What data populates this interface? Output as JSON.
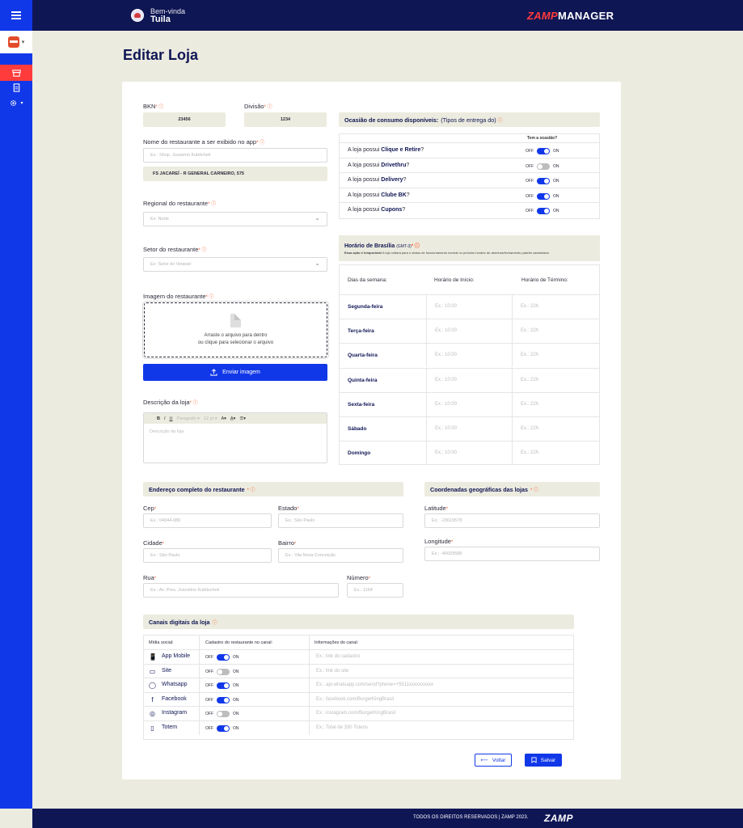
{
  "header": {
    "welcome_line": "Bem-vinda",
    "user_name": "Tuila",
    "brand_left": "ZAMP",
    "brand_right": "MANAGER"
  },
  "page": {
    "title": "Editar Loja"
  },
  "form": {
    "bkn": {
      "label": "BKN",
      "value": "23456"
    },
    "divisao": {
      "label": "Divisão",
      "value": "1234"
    },
    "nome_exibido": {
      "label": "Nome do restaurante a ser exibido no app",
      "placeholder": "Ex.: Shop. Jussemo Kubitchek",
      "value": "FS JACAREÍ - R GENERAL CARNEIRO, 575"
    },
    "regional": {
      "label": "Regional do restaurante",
      "placeholder": "Ex: Norte"
    },
    "setor": {
      "label": "Setor do restaurante",
      "placeholder": "Ex: Setor do Veiarari"
    },
    "imagem": {
      "label": "Imagem do restaurante",
      "drop_line1": "Arraste o arquivo para dentro",
      "drop_line2": "ou clique para selecionar o arquivo",
      "upload_label": "Enviar imagem"
    },
    "descricao": {
      "label": "Descrição da loja",
      "placeholder": "Descrição da loja",
      "toolbar": {
        "bold": "B",
        "italic": "I",
        "underline": "U",
        "style": "Paragrafo",
        "size": "12 pt"
      }
    }
  },
  "ocasiao": {
    "title_bold": "Ocasião de consumo disponíveis:",
    "title_rest": "(Tipos de entrega do)",
    "col_header": "Tem a ocasião?",
    "prefix": "A loja possui",
    "off_label": "OFF",
    "on_label": "ON",
    "rows": [
      {
        "name": "Clique e Retire",
        "on": true
      },
      {
        "name": "Drivethru",
        "on": false
      },
      {
        "name": "Delivery",
        "on": true
      },
      {
        "name": "Clube BK",
        "on": true
      },
      {
        "name": "Cupons",
        "on": true
      }
    ]
  },
  "horario": {
    "title": "Horário de Brasília",
    "tz": "(GMT-3)",
    "note_bold": "Essa ação é temporária!",
    "note": "A loja voltará para o status de funcionamento normal no próximo horário de abertura/fechamento padrão cadastrado.",
    "col_days": "Dias da semana:",
    "col_start": "Horário de Início:",
    "col_end": "Horário de Término:",
    "start_placeholder": "Ex.: 10:00",
    "end_placeholder": "Ex.: 22h",
    "days": [
      "Segunda-feira",
      "Terça-feira",
      "Quarta-feira",
      "Quinta-feira",
      "Sexta-feira",
      "Sábado",
      "Domingo"
    ]
  },
  "endereco": {
    "title": "Endereço completo do restaurante",
    "cep": {
      "label": "Cep",
      "placeholder": "Ex.: 04044-080"
    },
    "estado": {
      "label": "Estado",
      "placeholder": "Ex.: São Paulo"
    },
    "cidade": {
      "label": "Cidade",
      "placeholder": "Ex.: São Paulo"
    },
    "bairro": {
      "label": "Bairro",
      "placeholder": "Ex.: Vila Nova Conceição"
    },
    "rua": {
      "label": "Rua",
      "placeholder": "Ex.: Av. Pres. Juscelino Kubitschek"
    },
    "numero": {
      "label": "Número",
      "placeholder": "Ex.: 1164"
    }
  },
  "coordenadas": {
    "title": "Coordenadas geográficas das lojas",
    "latitude": {
      "label": "Latitude",
      "placeholder": "Ex.: -23619578"
    },
    "longitude": {
      "label": "Longitude",
      "placeholder": "Ex.: -46693588"
    }
  },
  "canais": {
    "title": "Canais digitais da loja",
    "col_midia": "Mídia social:",
    "col_cadastro": "Cadastro do restaurante no canal:",
    "col_info": "Informações do canal:",
    "off_label": "OFF",
    "on_label": "ON",
    "rows": [
      {
        "name": "App Mobile",
        "icon": "mobile-icon",
        "glyph": "📱",
        "on": true,
        "placeholder": "Ex.: link do cadastro"
      },
      {
        "name": "Site",
        "icon": "monitor-icon",
        "glyph": "▭",
        "on": false,
        "placeholder": "Ex.: link do site"
      },
      {
        "name": "Whatsapp",
        "icon": "whatsapp-icon",
        "glyph": "◯",
        "on": true,
        "placeholder": "Ex.: api.whatsapp.com/send?phone=+5511xxxxxxxxxx"
      },
      {
        "name": "Facebook",
        "icon": "facebook-icon",
        "glyph": "f",
        "on": true,
        "placeholder": "Ex.: facebook.com/BurgerKingBrasil"
      },
      {
        "name": "Instagram",
        "icon": "instagram-icon",
        "glyph": "◎",
        "on": false,
        "placeholder": "Ex.: instagram.com/BurgerKingBrasil"
      },
      {
        "name": "Totem",
        "icon": "totem-icon",
        "glyph": "▯",
        "on": true,
        "placeholder": "Ex.: Total de 330 Totens"
      }
    ]
  },
  "actions": {
    "back": "Voltar",
    "save": "Salvar"
  },
  "footer": {
    "copyright": "TODOS OS DIREITOS RESERVADOS | ZAMP 2023.",
    "logo": "ZAMP"
  },
  "colors": {
    "primary": "#1138e8",
    "navy": "#0f1654",
    "accent": "#ff3b3b",
    "beige": "#ecebdf"
  }
}
